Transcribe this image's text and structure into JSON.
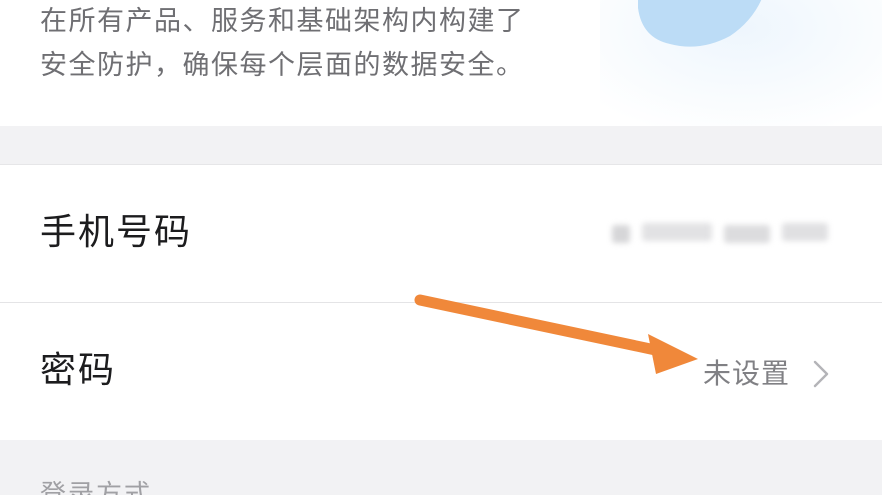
{
  "intro": {
    "line1": "在所有产品、服务和基础架构内构建了",
    "line2": "安全防护，确保每个层面的数据安全。"
  },
  "account_rows": [
    {
      "label": "手机号码",
      "value": ""
    },
    {
      "label": "密码",
      "value": "未设置"
    }
  ],
  "login_section": {
    "header": "登录方式"
  },
  "icons": {
    "shield": "shield-icon",
    "chevron": "chevron-right-icon",
    "annotation": "arrow-annotation"
  },
  "colors": {
    "shield": "#bcdcf6",
    "arrow": "#f0883a",
    "page_bg": "#f2f2f4"
  }
}
